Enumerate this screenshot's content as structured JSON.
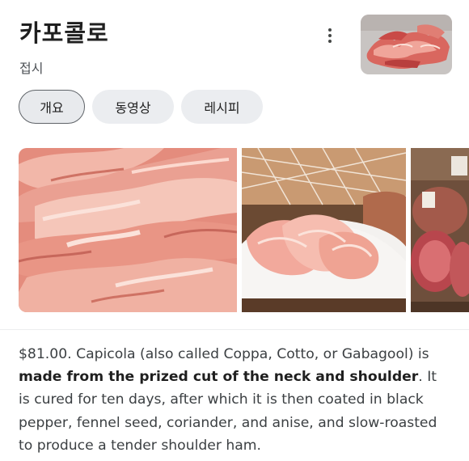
{
  "header": {
    "title": "카포콜로",
    "subtitle": "접시",
    "more_icon": "more-vert-icon"
  },
  "tabs": [
    {
      "label": "개요",
      "active": true
    },
    {
      "label": "동영상",
      "active": false
    },
    {
      "label": "레시피",
      "active": false
    }
  ],
  "colors": {
    "meat_pink": "#e9917f",
    "meat_light": "#f4c0b2",
    "chip_bg": "#ebedf0",
    "text": "#3c4043"
  },
  "description": {
    "lead": "$81.00. Capicola (also called Coppa, Cotto, or Gabagool) is ",
    "bold": "made from the prized cut of the neck and shoulder",
    "rest": ". It is cured for ten days, after which it is then coated in black pepper, fennel seed, coriander, and anise, and slow-roasted to produce a tender shoulder ham."
  }
}
